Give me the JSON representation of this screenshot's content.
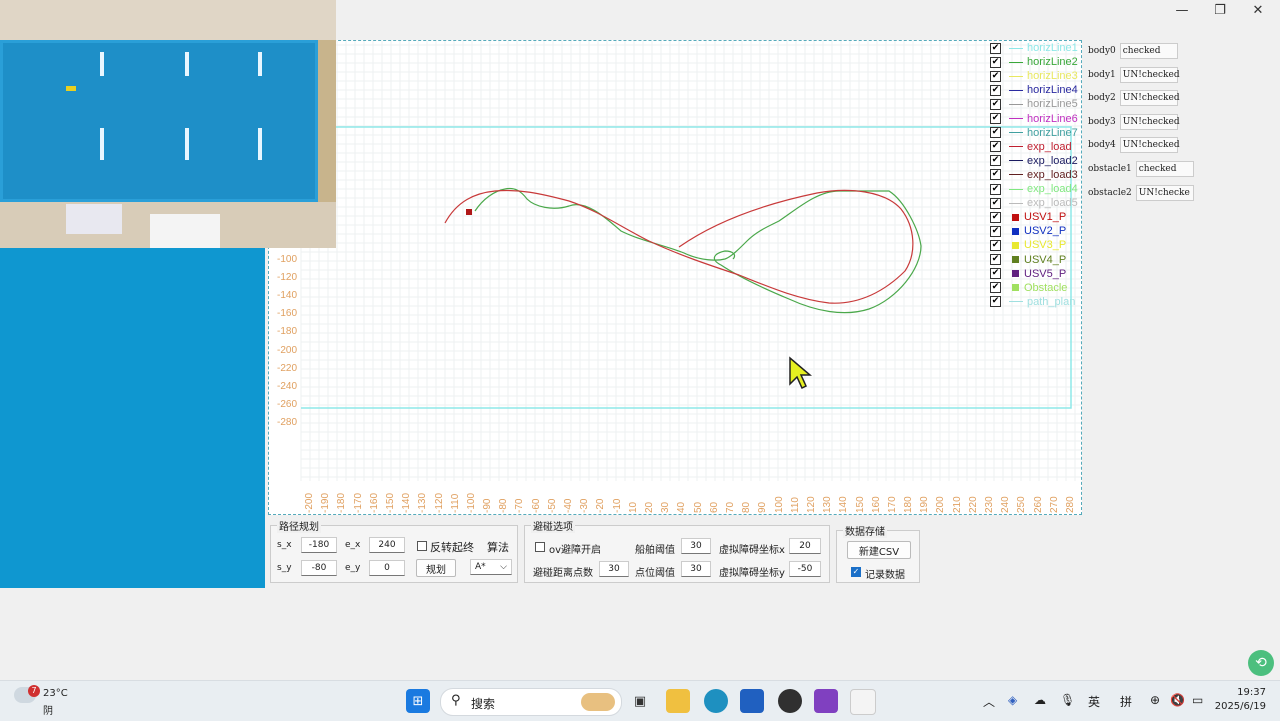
{
  "window": {
    "minimize": "—",
    "restore": "❐",
    "close": "✕"
  },
  "plot": {
    "y_ticks": [
      "-100",
      "-120",
      "-140",
      "-160",
      "-180",
      "-200",
      "-220",
      "-240",
      "-260",
      "-280"
    ],
    "x_ticks": [
      "-200",
      "-190",
      "-180",
      "-170",
      "-160",
      "-150",
      "-140",
      "-130",
      "-120",
      "-110",
      "-100",
      "-90",
      "-80",
      "-70",
      "-60",
      "-50",
      "-40",
      "-30",
      "-20",
      "-10",
      "10",
      "20",
      "30",
      "40",
      "50",
      "60",
      "70",
      "80",
      "90",
      "100",
      "110",
      "120",
      "130",
      "140",
      "150",
      "160",
      "170",
      "180",
      "190",
      "200",
      "210",
      "220",
      "230",
      "240",
      "250",
      "260",
      "270",
      "280"
    ],
    "tick_color": "#e0a060"
  },
  "legend": [
    {
      "label": "horizLine1",
      "color": "#8ee8e8",
      "kind": "line",
      "checked": "✔"
    },
    {
      "label": "horizLine2",
      "color": "#3aa83a",
      "kind": "line",
      "checked": "✔"
    },
    {
      "label": "horizLine3",
      "color": "#e8e860",
      "kind": "line",
      "checked": "✔"
    },
    {
      "label": "horizLine4",
      "color": "#2a2aa0",
      "kind": "line",
      "checked": "✔"
    },
    {
      "label": "horizLine5",
      "color": "#999999",
      "kind": "line",
      "checked": "✔"
    },
    {
      "label": "horizLine6",
      "color": "#c030c0",
      "kind": "line",
      "checked": "✔"
    },
    {
      "label": "horizLine7",
      "color": "#40a0a0",
      "kind": "line",
      "checked": "✔"
    },
    {
      "label": "exp_load",
      "color": "#c02030",
      "kind": "line",
      "checked": "✔"
    },
    {
      "label": "exp_load2",
      "color": "#1a1a60",
      "kind": "line",
      "checked": "✔"
    },
    {
      "label": "exp_load3",
      "color": "#602020",
      "kind": "line",
      "checked": "✔"
    },
    {
      "label": "exp_load4",
      "color": "#80e880",
      "kind": "line",
      "checked": "✔"
    },
    {
      "label": "exp_load5",
      "color": "#bbbbbb",
      "kind": "line",
      "checked": "✔"
    },
    {
      "label": "USV1_P",
      "color": "#c01010",
      "kind": "square",
      "checked": "✔"
    },
    {
      "label": "USV2_P",
      "color": "#1030c0",
      "kind": "square",
      "checked": "✔"
    },
    {
      "label": "USV3_P",
      "color": "#e8e830",
      "kind": "square",
      "checked": "✔"
    },
    {
      "label": "USV4_P",
      "color": "#608020",
      "kind": "square",
      "checked": "✔"
    },
    {
      "label": "USV5_P",
      "color": "#602080",
      "kind": "square",
      "checked": "✔"
    },
    {
      "label": "Obstacle",
      "color": "#a0e060",
      "kind": "square",
      "checked": "✔"
    },
    {
      "label": "path_plan",
      "color": "#a0e0e0",
      "kind": "line",
      "checked": "✔"
    }
  ],
  "bodies": [
    {
      "name": "body0",
      "state": "checked"
    },
    {
      "name": "body1",
      "state": "UN!checked"
    },
    {
      "name": "body2",
      "state": "UN!checked"
    },
    {
      "name": "body3",
      "state": "UN!checked"
    },
    {
      "name": "body4",
      "state": "UN!checked"
    },
    {
      "name": "obstacle1",
      "state": "checked"
    },
    {
      "name": "obstacle2",
      "state": "UN!checke"
    }
  ],
  "path_planning": {
    "title": "路径规划",
    "sx_label": "s_x",
    "sx": "-180",
    "ex_label": "e_x",
    "ex": "240",
    "sy_label": "s_y",
    "sy": "-80",
    "ey_label": "e_y",
    "ey": "0",
    "reverse_label": "反转起终",
    "algo_label": "算法",
    "plan_button": "规划",
    "algo_value": "A*"
  },
  "collision": {
    "title": "避碰选项",
    "ov_label": "ov避障开启",
    "ship_threshold_label": "船舶阈值",
    "ship_threshold": "30",
    "virt_x_label": "虚拟障碍坐标x",
    "virt_x": "20",
    "dist_points_label": "避碰距离点数",
    "dist_points": "30",
    "point_threshold_label": "点位阈值",
    "point_threshold": "30",
    "virt_y_label": "虚拟障碍坐标y",
    "virt_y": "-50"
  },
  "storage": {
    "title": "数据存储",
    "new_csv": "新建CSV",
    "record_label": "记录数据"
  },
  "taskbar": {
    "weather_temp": "23°C",
    "weather_desc": "阴",
    "weather_badge": "7",
    "search_label": "搜索",
    "ime_lang": "英",
    "ime_mode": "拼",
    "time": "19:37",
    "date": "2025/6/19"
  }
}
